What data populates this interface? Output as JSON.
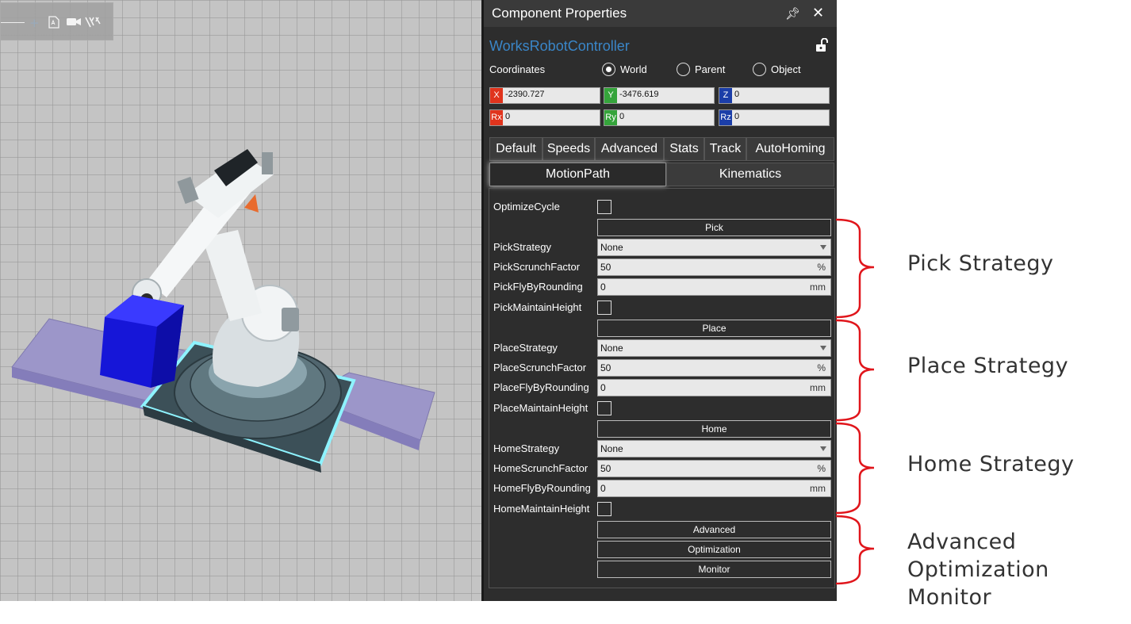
{
  "viewport": {
    "toolbar_icons": [
      "plus-icon",
      "pdf-icon",
      "video-camera-icon",
      "measure-icon"
    ]
  },
  "panel": {
    "title": "Component Properties",
    "component_name": "WorksRobotController",
    "coordinates_label": "Coordinates",
    "radios": [
      {
        "label": "World",
        "checked": true
      },
      {
        "label": "Parent",
        "checked": false
      },
      {
        "label": "Object",
        "checked": false
      }
    ],
    "coords": {
      "x_tag": "X",
      "x": "-2390.727",
      "y_tag": "Y",
      "y": "-3476.619",
      "z_tag": "Z",
      "z": "0",
      "rx_tag": "Rx",
      "rx": "0",
      "ry_tag": "Ry",
      "ry": "0",
      "rz_tag": "Rz",
      "rz": "0"
    },
    "tabs_row1": [
      "Default",
      "Speeds",
      "Advanced",
      "Stats",
      "Track",
      "AutoHoming"
    ],
    "tabs_row2": [
      "MotionPath",
      "Kinematics"
    ],
    "active_tab": "MotionPath",
    "props": {
      "optimize_cycle": "OptimizeCycle",
      "pick_btn": "Pick",
      "pick_strategy": "PickStrategy",
      "pick_strategy_val": "None",
      "pick_scrunch": "PickScrunchFactor",
      "pick_scrunch_val": "50",
      "pick_flyby": "PickFlyByRounding",
      "pick_flyby_val": "0",
      "pick_maintain": "PickMaintainHeight",
      "place_btn": "Place",
      "place_strategy": "PlaceStrategy",
      "place_strategy_val": "None",
      "place_scrunch": "PlaceScrunchFactor",
      "place_scrunch_val": "50",
      "place_flyby": "PlaceFlyByRounding",
      "place_flyby_val": "0",
      "place_maintain": "PlaceMaintainHeight",
      "home_btn": "Home",
      "home_strategy": "HomeStrategy",
      "home_strategy_val": "None",
      "home_scrunch": "HomeScrunchFactor",
      "home_scrunch_val": "50",
      "home_flyby": "HomeFlyByRounding",
      "home_flyby_val": "0",
      "home_maintain": "HomeMaintainHeight",
      "advanced_btn": "Advanced",
      "optimization_btn": "Optimization",
      "monitor_btn": "Monitor",
      "unit_percent": "%",
      "unit_mm": "mm"
    }
  },
  "annotations": {
    "pick": "Pick Strategy",
    "place": "Place Strategy",
    "home": "Home Strategy",
    "adv_line1": "Advanced",
    "adv_line2": "Optimization",
    "adv_line3": "Monitor",
    "bracket_color": "#e0151b"
  }
}
